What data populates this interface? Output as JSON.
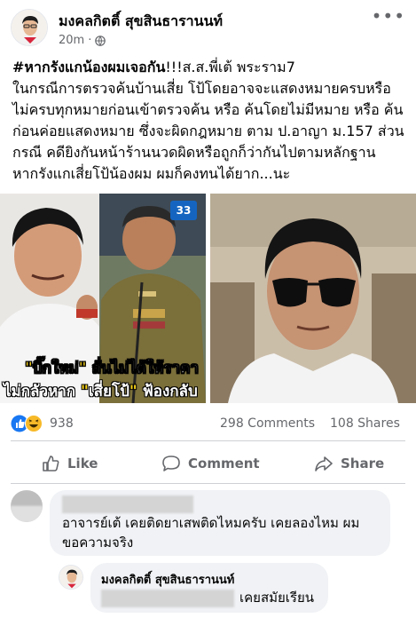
{
  "post": {
    "author": "มงคลกิตติ์ สุขสินธารานนท์",
    "time": "20m",
    "separator": "·",
    "privacy_icon": "globe-icon",
    "more_icon": "•••",
    "text_lines": [
      {
        "hashtag": "#หากรังแกน้องผมเจอกัน",
        "rest": "!!!ส.ส.พี่เต้ พระราม7"
      },
      {
        "hashtag": "",
        "rest": "ในกรณีการตรวจค้นบ้านเสี่ย โป้โดยอาจจะแสดงหมายครบหรือ"
      },
      {
        "hashtag": "",
        "rest": "ไม่ครบทุกหมายก่อนเข้าตรวจค้น หรือ ค้นโดยไม่มีหมาย หรือ ค้น"
      },
      {
        "hashtag": "",
        "rest": "ก่อนค่อยแสดงหมาย ซึ่งจะผิดกฎหมาย ตาม ป.อาญา ม.157 ส่วน"
      },
      {
        "hashtag": "",
        "rest": "กรณี คดียิงกันหน้าร้านนวดผิดหรือถูกก็ว่ากันไปตามหลักฐาน"
      },
      {
        "hashtag": "",
        "rest": "หากรังแกเสี่ยโป้น้องผม ผมก็คงทนได้ยาก...นะ"
      }
    ],
    "image_caption": {
      "line1_q1": "\"",
      "line1_b": "บิ๊กใหม่",
      "line1_q2": "\"",
      "line1_rest": " ลั่นไม่ได้ให้ราคา",
      "line2_a": "ไม่กลัวหาก ",
      "line2_q1": "\"",
      "line2_b": "เสี่ยโป้",
      "line2_q2": "\"",
      "line2_rest": " ฟ้องกลับ"
    },
    "channel_badge": "33"
  },
  "stats": {
    "reactions_count": "938",
    "comments": "298 Comments",
    "shares": "108 Shares"
  },
  "actions": {
    "like": "Like",
    "comment": "Comment",
    "share": "Share"
  },
  "comments": [
    {
      "text_line1": "อาจารย์เต้ เคยติดยาเสพติดไหมครับ เคยลองไหม ผม",
      "text_line2": "ขอความจริง"
    },
    {
      "author": "มงคลกิตติ์ สุขสินธารานนท์",
      "reply_text": "เคยสมัยเรียน"
    }
  ],
  "colors": {
    "like_blue": "#1877f2",
    "haha_yellow": "#f7b928",
    "text_secondary": "#65676b",
    "bubble_bg": "#f0f2f5"
  }
}
